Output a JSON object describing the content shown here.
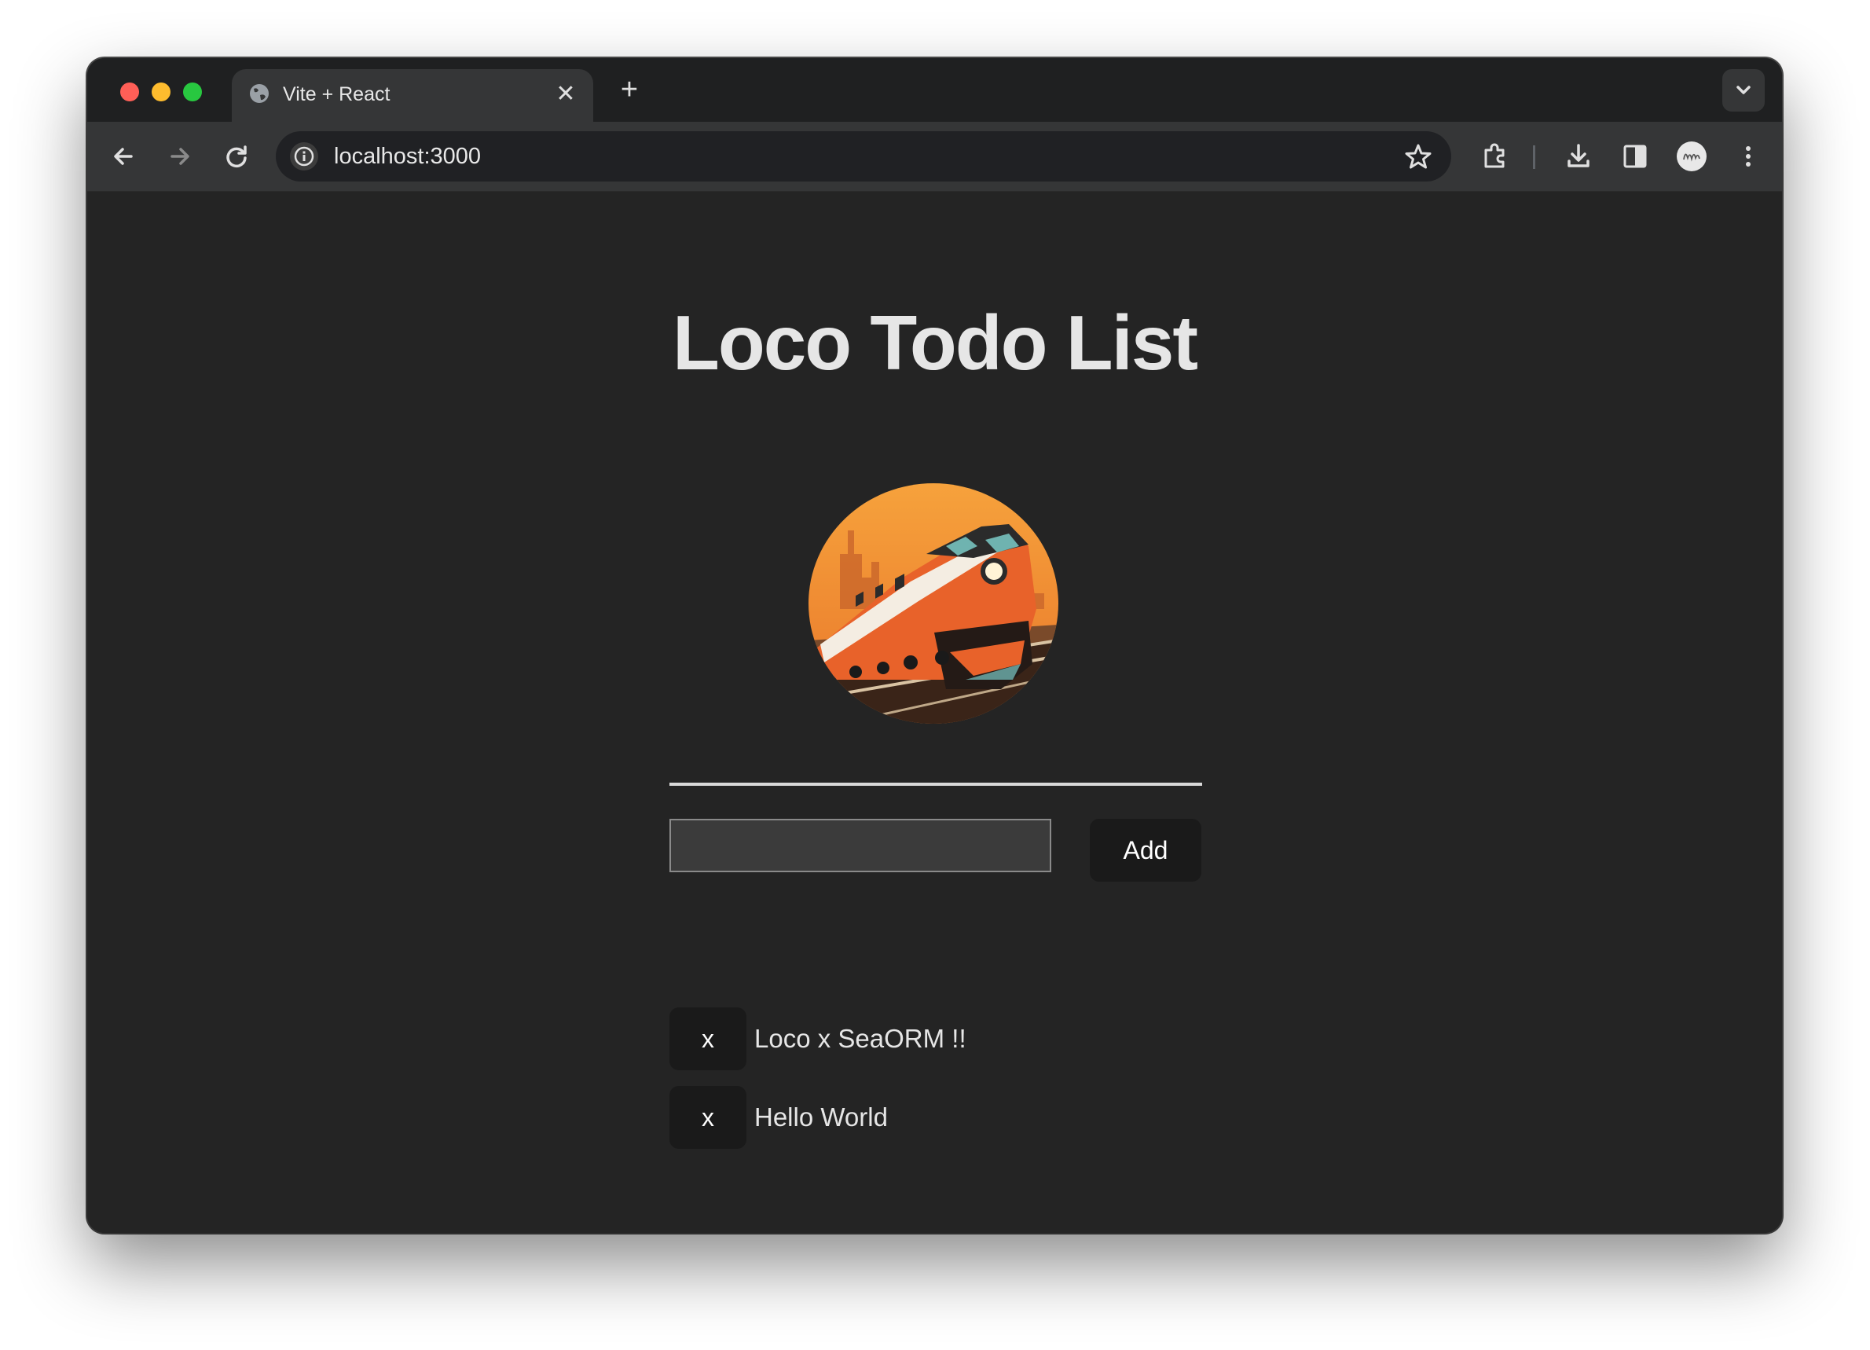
{
  "browser": {
    "tab_title": "Vite + React",
    "tab_close": "✕",
    "new_tab": "+",
    "url": "localhost:3000"
  },
  "icons": {
    "tab": "globe-icon",
    "back": "arrow-left-icon",
    "forward": "arrow-right-icon",
    "reload": "reload-icon",
    "site_info": "info-icon",
    "bookmark": "star-icon",
    "extensions": "puzzle-icon",
    "downloads": "download-icon",
    "side_panel": "side-panel-icon",
    "profile": "avatar",
    "menu": "kebab-menu-icon",
    "tab_search": "chevron-down-icon"
  },
  "app": {
    "title": "Loco Todo List",
    "input_value": "",
    "add_label": "Add",
    "todos": [
      {
        "delete_label": "x",
        "text": "Loco x SeaORM !!"
      },
      {
        "delete_label": "x",
        "text": "Hello World"
      }
    ]
  },
  "colors": {
    "page_bg": "#242424",
    "title": "#e6e6e6",
    "button_bg": "#1a1a1a",
    "logo_orange": "#f08a3a"
  }
}
